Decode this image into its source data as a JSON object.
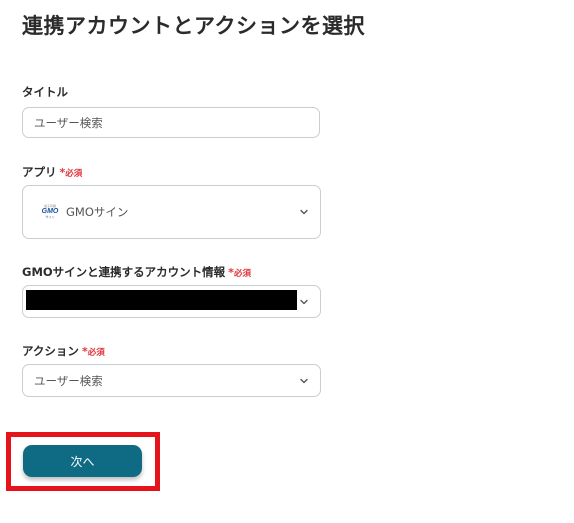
{
  "page_title": "連携アカウントとアクションを選択",
  "required_label": "必須",
  "required_mark": "*",
  "fields": {
    "title": {
      "label": "タイトル",
      "value": "ユーザー検索"
    },
    "app": {
      "label": "アプリ",
      "value": "GMOサイン",
      "logo_icon": "gmo-sign-logo",
      "logo_text_top": "電子印鑑",
      "logo_text_mid": "GMO",
      "logo_text_bottom": "サイン"
    },
    "account": {
      "label": "GMOサインと連携するアカウント情報",
      "value_redacted": true
    },
    "action": {
      "label": "アクション",
      "value": "ユーザー検索"
    }
  },
  "next_button": {
    "label": "次へ"
  },
  "colors": {
    "button_bg": "#0f6b84",
    "required": "#e0343b",
    "highlight": "#e5141a",
    "border": "#c9ced4"
  }
}
